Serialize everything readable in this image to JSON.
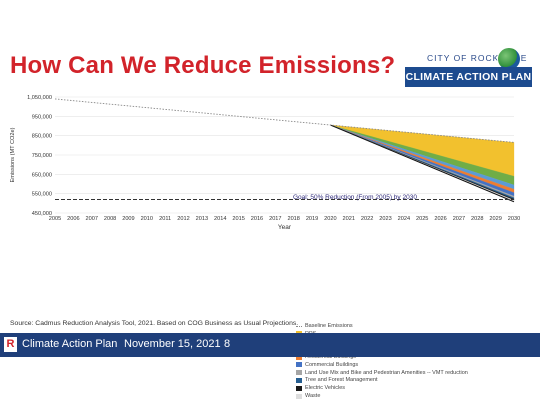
{
  "slide": {
    "title": "How Can We Reduce Emissions?",
    "source": "Source: Cadmus Reduction Analysis Tool, 2021. Based on COG Business as Usual Projections."
  },
  "logo": {
    "city": "CITY OF ROCKVILLE",
    "plan": "CLIMATE ACTION PLAN"
  },
  "footer": {
    "logo_letter": "R",
    "program": "Climate Action Plan",
    "date": "November 15, 2021",
    "page": "8",
    "background": "#1f3f7a"
  },
  "colors": {
    "title": "#d2232a",
    "brand_blue": "#1d4b8f"
  },
  "chart_data": {
    "type": "area",
    "xlabel": "Year",
    "ylabel": "Emissions (MT CO2e)",
    "ylim": [
      450000,
      1050000
    ],
    "yticks": [
      450000,
      550000,
      650000,
      750000,
      850000,
      950000,
      1050000
    ],
    "ytick_labels": [
      "450,000",
      "550,000",
      "650,000",
      "750,000",
      "850,000",
      "950,000",
      "1,050,000"
    ],
    "x": [
      2005,
      2006,
      2007,
      2008,
      2009,
      2010,
      2011,
      2012,
      2013,
      2014,
      2015,
      2016,
      2017,
      2018,
      2019,
      2020,
      2021,
      2022,
      2023,
      2024,
      2025,
      2026,
      2027,
      2028,
      2029,
      2030
    ],
    "x_tick_labels": [
      "2005",
      "2006",
      "2007",
      "2008",
      "2009",
      "2010",
      "2011",
      "2012",
      "2013",
      "2014",
      "2015",
      "2016",
      "2017",
      "2018",
      "2019",
      "2020",
      "2021",
      "2022",
      "2023",
      "2024",
      "2025",
      "2026",
      "2027",
      "2028",
      "2029",
      "2030"
    ],
    "grid": true,
    "baseline": {
      "name": "Baseline Emissions",
      "values": [
        1040000,
        1031000,
        1022000,
        1013000,
        1004000,
        995000,
        986000,
        977000,
        968000,
        959000,
        950000,
        941000,
        932000,
        923000,
        914000,
        905000,
        896000,
        887000,
        878000,
        869000,
        860000,
        851000,
        842000,
        833000,
        824000,
        815000
      ],
      "style": "dotted"
    },
    "wedge_start_year": 2020,
    "base_bottom_2030": 508000,
    "series": [
      {
        "name": "RPS",
        "values_2030": 175000,
        "color": "#f2c12e"
      },
      {
        "name": "Green Power Purchases",
        "values_2030": 45000,
        "color": "#70ad47"
      },
      {
        "name": "Solar Energy Installations",
        "values_2030": 22000,
        "color": "#5b9bd5"
      },
      {
        "name": "Residential Buildings",
        "values_2030": 18000,
        "color": "#ed7d31"
      },
      {
        "name": "Commercial Buildings",
        "values_2030": 18000,
        "color": "#4472c4"
      },
      {
        "name": "Land Use Mix and Bike and Pedestrian Amenities -- VMT reduction",
        "values_2030": 8000,
        "color": "#a5a5a5"
      },
      {
        "name": "Tree and Forest Management",
        "values_2030": 7000,
        "color": "#255e91"
      },
      {
        "name": "Electric Vehicles",
        "values_2030": 6000,
        "color": "#1a1a1a"
      },
      {
        "name": "Waste",
        "values_2030": 8000,
        "color": "#dddddd"
      }
    ],
    "goal": {
      "label": "Goal: 50% Reduction (From 2005) by 2030",
      "value": 520000,
      "color": "#2e2a7a"
    }
  }
}
